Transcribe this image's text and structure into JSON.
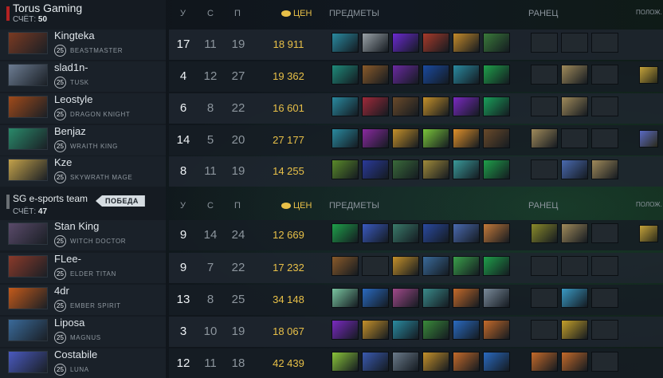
{
  "teams": [
    {
      "name": "Torus Gaming",
      "score_label": "СЧЁТ:",
      "score": "50",
      "bar_color": "#b32222",
      "winner_badge": ""
    },
    {
      "name": "SG e-sports team",
      "score_label": "СЧЁТ:",
      "score": "47",
      "bar_color": "#6a6f74",
      "winner_badge": "ПОБЕДА"
    }
  ],
  "columns": {
    "kills": "У",
    "deaths": "С",
    "assists": "П",
    "gold": "ЦЕН",
    "items": "ПРЕДМЕТЫ",
    "backpack": "РАНЕЦ",
    "neutral": "ПОЛОЖ."
  },
  "rows": [
    {
      "player": "Kingteka",
      "level": "25",
      "hero": "BEASTMASTER",
      "k": "17",
      "d": "11",
      "a": "19",
      "gold": "18 911",
      "portrait": "#7a3a22",
      "items": [
        "#2a8aa0",
        "#9aa2a8",
        "#6b2ad0",
        "#a83a2a",
        "#c48a2a",
        "#3a7a3a"
      ],
      "backpack": [
        "",
        "",
        ""
      ],
      "neutral": ""
    },
    {
      "player": "slad1n-",
      "level": "25",
      "hero": "TUSK",
      "k": "4",
      "d": "12",
      "a": "27",
      "gold": "19 362",
      "portrait": "#6c7c92",
      "items": [
        "#1f8a7a",
        "#8a5a2a",
        "#6a2aa0",
        "#1a4aa0",
        "#2a8aa0",
        "#1fa04a"
      ],
      "backpack": [
        "",
        "#a08a5a",
        ""
      ],
      "neutral": "#c4a23a"
    },
    {
      "player": "Leostyle",
      "level": "25",
      "hero": "DRAGON KNIGHT",
      "k": "6",
      "d": "8",
      "a": "22",
      "gold": "16 601",
      "portrait": "#a04a1a",
      "items": [
        "#2a8aa0",
        "#a02a3a",
        "#6a4a2a",
        "#c4902a",
        "#7a2ac0",
        "#1aa05a"
      ],
      "backpack": [
        "",
        "#a08a5a",
        ""
      ],
      "neutral": ""
    },
    {
      "player": "Benjaz",
      "level": "25",
      "hero": "WRAITH KING",
      "k": "14",
      "d": "5",
      "a": "20",
      "gold": "27 177",
      "portrait": "#2a8a6a",
      "items": [
        "#2a8aa0",
        "#8a2aa0",
        "#c4902a",
        "#7ac43a",
        "#e0902a",
        "#6a4a2a"
      ],
      "backpack": [
        "#a08a5a",
        "",
        ""
      ],
      "neutral": "#5a6ac4"
    },
    {
      "player": "Kze",
      "level": "25",
      "hero": "SKYWRATH MAGE",
      "k": "8",
      "d": "11",
      "a": "19",
      "gold": "14 255",
      "portrait": "#c4a24a",
      "items": [
        "#5a8a2a",
        "#2a3a9a",
        "#3a6a3a",
        "#a08a3a",
        "#3a9a9a",
        "#1fa04a"
      ],
      "backpack": [
        "",
        "#4a6ab0",
        "#a08a5a"
      ],
      "neutral": ""
    },
    {
      "player": "Stan King",
      "level": "25",
      "hero": "WITCH DOCTOR",
      "k": "9",
      "d": "14",
      "a": "24",
      "gold": "12 669",
      "portrait": "#5a4a6a",
      "items": [
        "#1fa04a",
        "#3a5ac0",
        "#3a7a6a",
        "#2a4aa0",
        "#4a6ab0",
        "#c47a3a"
      ],
      "backpack": [
        "#8a8a2a",
        "#a08a5a",
        ""
      ],
      "neutral": "#c4a23a"
    },
    {
      "player": "FLee-",
      "level": "25",
      "hero": "ELDER TITAN",
      "k": "9",
      "d": "7",
      "a": "22",
      "gold": "17 232",
      "portrait": "#8a3a2a",
      "items": [
        "#8a5a2a",
        "",
        "#c4902a",
        "#3a6a9a",
        "#3aa04a",
        "#1fa04a"
      ],
      "backpack": [
        "",
        "",
        ""
      ],
      "neutral": ""
    },
    {
      "player": "4dr",
      "level": "25",
      "hero": "EMBER SPIRIT",
      "k": "13",
      "d": "8",
      "a": "25",
      "gold": "34 148",
      "portrait": "#c45a1a",
      "items": [
        "#7ac4a0",
        "#2a6ac0",
        "#a04a8a",
        "#3a8a8a",
        "#c46a2a",
        "#7a8a9a"
      ],
      "backpack": [
        "",
        "#3a9ac4",
        ""
      ],
      "neutral": ""
    },
    {
      "player": "Liposa",
      "level": "25",
      "hero": "MAGNUS",
      "k": "3",
      "d": "10",
      "a": "19",
      "gold": "18 067",
      "portrait": "#3a6a9a",
      "items": [
        "#7a2ac0",
        "#c4902a",
        "#2a8aa0",
        "#3a8a3a",
        "#2a6ac0",
        "#c46a2a"
      ],
      "backpack": [
        "",
        "#c4a02a",
        ""
      ],
      "neutral": ""
    },
    {
      "player": "Costabile",
      "level": "25",
      "hero": "LUNA",
      "k": "12",
      "d": "11",
      "a": "18",
      "gold": "42 439",
      "portrait": "#4a5ac0",
      "items": [
        "#8ac43a",
        "#3a5ab0",
        "#6a7a8a",
        "#c4902a",
        "#c46a2a",
        "#2a6ac0"
      ],
      "backpack": [
        "#c46a2a",
        "#c46a2a",
        ""
      ],
      "neutral": ""
    }
  ]
}
